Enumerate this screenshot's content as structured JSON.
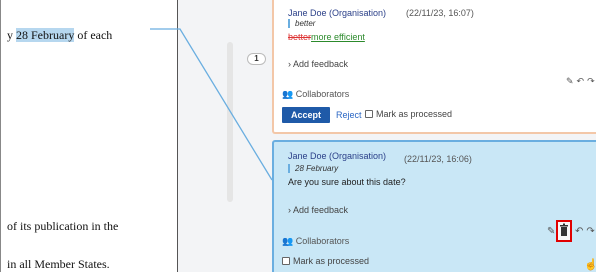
{
  "document": {
    "lines": [
      {
        "before": "y ",
        "highlight": "28 February",
        "after": " of each"
      },
      {
        "before": "of its publication in the",
        "highlight": "",
        "after": ""
      },
      {
        "before": "in all Member States.",
        "highlight": "",
        "after": ""
      }
    ]
  },
  "gutter": {
    "comment_count": "1"
  },
  "card1": {
    "author": "Jane Doe (Organisation)",
    "timestamp": "(22/11/23, 16:07)",
    "quote": "better",
    "deleted_text": "better",
    "inserted_text": "more efficient",
    "add_feedback": "› Add feedback",
    "collaborators": "Collaborators",
    "accept_label": "Accept",
    "reject_label": "Reject",
    "mark_processed": "Mark as processed"
  },
  "card2": {
    "author": "Jane Doe (Organisation)",
    "timestamp": "(22/11/23, 16:06)",
    "quote": "28 February",
    "comment": "Are you sure about this date?",
    "add_feedback": "› Add feedback",
    "collaborators": "Collaborators",
    "mark_processed": "Mark as processed"
  },
  "icons": {
    "edit": "pencil-icon",
    "reply": "reply-icon",
    "forward": "forward-icon",
    "delete": "trash-icon",
    "collaborators": "people-icon"
  },
  "colors": {
    "highlight": "#b6d7ef",
    "active_card": "#c9e7f6",
    "active_border": "#6aaee0",
    "accept_button": "#1f5aa8",
    "delete_focus": "#e00000",
    "deleted_text": "#dd3333",
    "inserted_text": "#2c8a2c"
  }
}
